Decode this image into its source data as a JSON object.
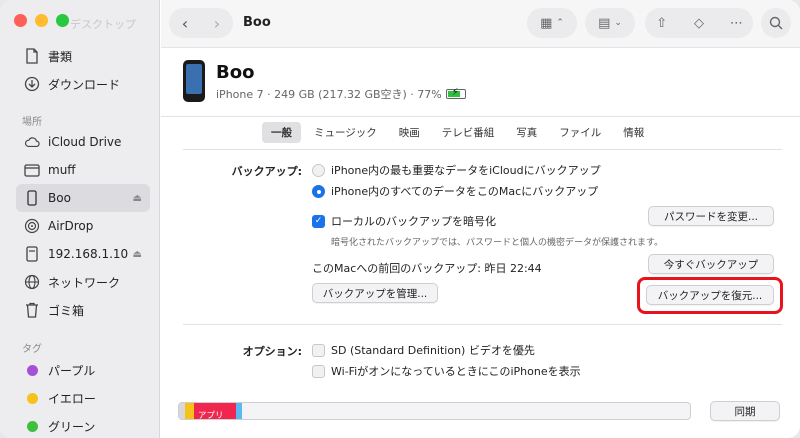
{
  "window": {
    "title": "Boo"
  },
  "sidebar": {
    "faded_label": "デスクトップ",
    "favorites": [
      {
        "label": "書類",
        "icon": "document-icon"
      },
      {
        "label": "ダウンロード",
        "icon": "download-icon"
      }
    ],
    "locations_heading": "場所",
    "locations": [
      {
        "label": "iCloud Drive",
        "icon": "cloud-icon"
      },
      {
        "label": "muff",
        "icon": "folder-icon"
      },
      {
        "label": "Boo",
        "icon": "iphone-icon",
        "selected": true,
        "eject": true
      },
      {
        "label": "AirDrop",
        "icon": "airdrop-icon"
      },
      {
        "label": "192.168.1.10",
        "icon": "server-icon",
        "eject": true
      },
      {
        "label": "ネットワーク",
        "icon": "network-icon"
      },
      {
        "label": "ゴミ箱",
        "icon": "trash-icon"
      }
    ],
    "tags_heading": "タグ",
    "tags": [
      {
        "label": "パープル",
        "color": "#a550d7"
      },
      {
        "label": "イエロー",
        "color": "#f7c21a"
      },
      {
        "label": "グリーン",
        "color": "#3ec03e"
      }
    ]
  },
  "device": {
    "name": "Boo",
    "info": "iPhone 7 · 249 GB (217.32 GB空き) · 77%",
    "battery_level": 0.77
  },
  "tabs": [
    "一般",
    "ミュージック",
    "映画",
    "テレビ番組",
    "写真",
    "ファイル",
    "情報"
  ],
  "backup": {
    "label": "バックアップ:",
    "option_icloud": "iPhone内の最も重要なデータをiCloudにバックアップ",
    "option_mac": "iPhone内のすべてのデータをこのMacにバックアップ",
    "encrypt_label": "ローカルのバックアップを暗号化",
    "encrypt_note": "暗号化されたバックアップでは、パスワードと個人の機密データが保護されます。",
    "change_password": "パスワードを変更...",
    "last_backup": "このMacへの前回のバックアップ: 昨日 22:44",
    "backup_now": "今すぐバックアップ",
    "manage": "バックアップを管理...",
    "restore": "バックアップを復元..."
  },
  "options": {
    "label": "オプション:",
    "sd_video": "SD (Standard Definition) ビデオを優先",
    "wifi_show": "Wi-FiがオンになっているときにこのiPhoneを表示"
  },
  "storage": {
    "app_label": "アプリ",
    "sync": "同期",
    "colors": {
      "yellow": "#f6c21a",
      "apps": "#f0264f",
      "blue": "#5ab9f0"
    }
  }
}
